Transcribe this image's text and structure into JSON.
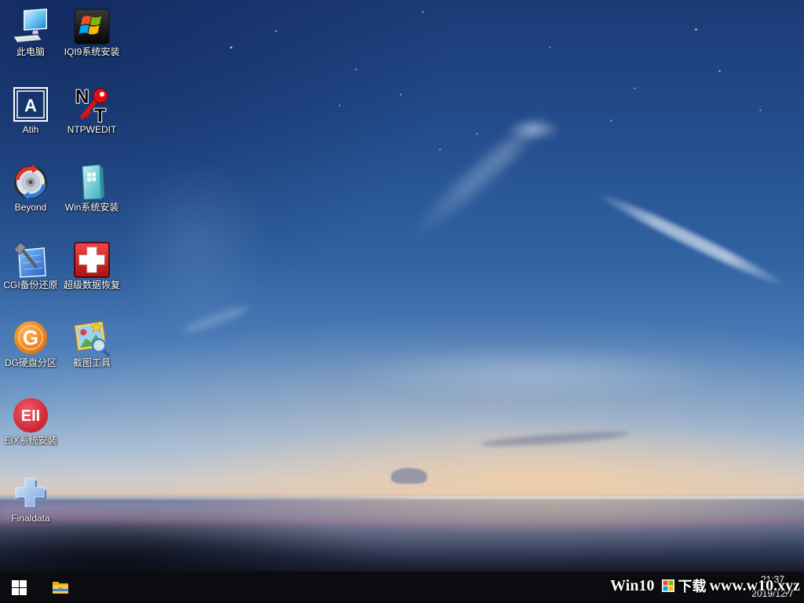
{
  "desktop": {
    "columns": [
      {
        "items": [
          {
            "label": "此电脑",
            "icon": "this-pc-icon"
          },
          {
            "label": "Atih",
            "icon": "atih-icon"
          },
          {
            "label": "Beyond",
            "icon": "beyond-disc-icon"
          },
          {
            "label": "CGI备份还原",
            "icon": "cgi-hammer-icon"
          },
          {
            "label": "DG硬盘分区",
            "icon": "diskgenius-icon"
          },
          {
            "label": "EIX系统安装",
            "icon": "eix-icon"
          },
          {
            "label": "Finaldata",
            "icon": "finaldata-icon"
          }
        ]
      },
      {
        "items": [
          {
            "label": "IQI9系统安装",
            "icon": "windows-flag-icon"
          },
          {
            "label": "NTPWEDIT",
            "icon": "ntpwedit-key-icon"
          },
          {
            "label": "Win系统安装",
            "icon": "win-install-icon"
          },
          {
            "label": "超级数据恢复",
            "icon": "data-recovery-cross-icon"
          },
          {
            "label": "截图工具",
            "icon": "snipping-tool-icon"
          }
        ]
      }
    ]
  },
  "logos": {
    "atih": "A",
    "ntpwedit_n": "N",
    "ntpwedit_t": "T",
    "diskgenius": "G",
    "eix": "EII"
  },
  "taskbar": {
    "start": {
      "icon": "windows-logo-icon"
    },
    "pinned": [
      {
        "icon": "file-explorer-icon"
      }
    ],
    "clock": {
      "time": "21:37",
      "date": "2019/12/7"
    }
  },
  "watermark": {
    "brand": "Win10",
    "download": "下载",
    "url": "www.w10.xyz"
  },
  "colors": {
    "taskbar_bg": "#0b0b10",
    "label_text": "#ffffff",
    "sky_top": "#1c3b76",
    "horizon_glow": "#d8c8b8",
    "sea": "#4e5a7a"
  }
}
